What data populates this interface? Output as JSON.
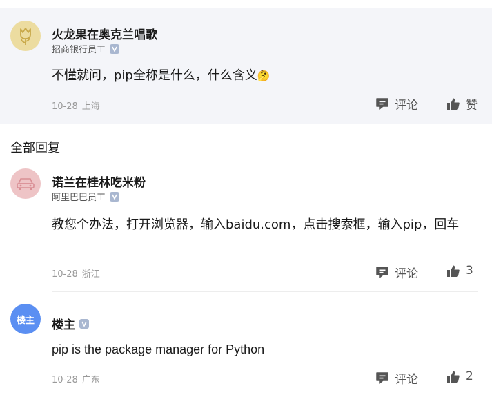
{
  "main_comment": {
    "author": "火龙果在奥克兰唱歌",
    "role": "招商银行员工",
    "text": "不懂就问，pip全称是什么，什么含义",
    "emoji": "🤔",
    "date": "10-28",
    "location": "上海",
    "comment_label": "评论",
    "like_label": "赞"
  },
  "section_title": "全部回复",
  "replies": [
    {
      "author": "诺兰在桂林吃米粉",
      "role": "阿里巴巴员工",
      "text": "教您个办法，打开浏览器，输入baidu.com，点击搜索框，输入pip，回车",
      "date": "10-28",
      "location": "浙江",
      "comment_label": "评论",
      "likes": "3"
    },
    {
      "author": "楼主",
      "avatar_text": "楼主",
      "text": "pip is the package manager for Python",
      "date": "10-28",
      "location": "广东",
      "comment_label": "评论",
      "likes": "2"
    }
  ],
  "colors": {
    "card_bg": "#f4f5f9",
    "avatar1_bg": "#ecdca0",
    "avatar2_bg": "#eec4c6",
    "avatar3_bg": "#5b8ff2",
    "verified_badge": "#a9b7d0"
  }
}
